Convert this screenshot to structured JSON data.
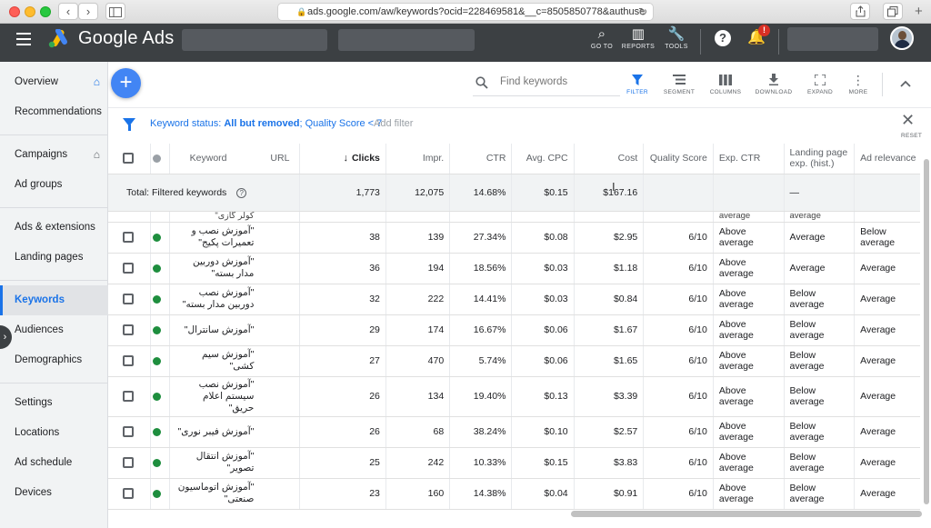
{
  "browser": {
    "url": "ads.google.com/aw/keywords?ocid=228469581&__c=8505850778&authuse",
    "back_glyph": "‹",
    "forward_glyph": "›"
  },
  "header": {
    "brand": "Google Ads",
    "tools": [
      {
        "label": "GO TO",
        "icon": "search-icon"
      },
      {
        "label": "REPORTS",
        "icon": "reports-icon"
      },
      {
        "label": "TOOLS",
        "icon": "wrench-icon"
      }
    ],
    "help_glyph": "?",
    "notification_badge": "!"
  },
  "sidebar": {
    "items": [
      {
        "label": "Overview"
      },
      {
        "label": "Recommendations"
      },
      {
        "label": "Campaigns"
      },
      {
        "label": "Ad groups"
      },
      {
        "label": "Ads & extensions"
      },
      {
        "label": "Landing pages"
      },
      {
        "label": "Keywords"
      },
      {
        "label": "Audiences"
      },
      {
        "label": "Demographics"
      },
      {
        "label": "Settings"
      },
      {
        "label": "Locations"
      },
      {
        "label": "Ad schedule"
      },
      {
        "label": "Devices"
      }
    ]
  },
  "toolbar": {
    "search_placeholder": "Find keywords",
    "tools": [
      {
        "label": "FILTER",
        "icon": "filter-icon"
      },
      {
        "label": "SEGMENT",
        "icon": "segment-icon"
      },
      {
        "label": "COLUMNS",
        "icon": "columns-icon"
      },
      {
        "label": "DOWNLOAD",
        "icon": "download-icon"
      },
      {
        "label": "EXPAND",
        "icon": "expand-icon"
      },
      {
        "label": "MORE",
        "icon": "more-icon"
      }
    ]
  },
  "filter": {
    "prefix": "Keyword status: ",
    "status_value": "All but removed",
    "sep": "; ",
    "quality": "Quality Score < 7",
    "add_filter": "Add filter",
    "reset": "RESET"
  },
  "table": {
    "headers": {
      "keyword": "Keyword",
      "url": "URL",
      "clicks": "Clicks",
      "impr": "Impr.",
      "ctr": "CTR",
      "avg_cpc": "Avg. CPC",
      "cost": "Cost",
      "quality_score": "Quality Score",
      "exp_ctr": "Exp. CTR",
      "landing_exp": "Landing page exp. (hist.)",
      "ad_relevance": "Ad relevance"
    },
    "total": {
      "label": "Total: Filtered keywords",
      "clicks": "1,773",
      "impr": "12,075",
      "ctr": "14.68%",
      "avg_cpc": "$0.15",
      "cost": "$167.16",
      "landing": "—"
    },
    "partial_row": {
      "keyword": "کولر گازی\"",
      "exp_ctr": "average",
      "landing": "average"
    },
    "rows": [
      {
        "keyword": "\"آموزش نصب و تعمیرات پکیج\"",
        "clicks": "38",
        "impr": "139",
        "ctr": "27.34%",
        "cpc": "$0.08",
        "cost": "$2.95",
        "qs": "6/10",
        "exp_ctr": "Above average",
        "landing": "Average",
        "relevance": "Below average"
      },
      {
        "keyword": "\"آموزش دوربین مدار بسته\"",
        "clicks": "36",
        "impr": "194",
        "ctr": "18.56%",
        "cpc": "$0.03",
        "cost": "$1.18",
        "qs": "6/10",
        "exp_ctr": "Above average",
        "landing": "Average",
        "relevance": "Average"
      },
      {
        "keyword": "\"آموزش نصب دوربین مدار بسته\"",
        "clicks": "32",
        "impr": "222",
        "ctr": "14.41%",
        "cpc": "$0.03",
        "cost": "$0.84",
        "qs": "6/10",
        "exp_ctr": "Above average",
        "landing": "Below average",
        "relevance": "Average"
      },
      {
        "keyword": "\"آموزش سانترال\"",
        "clicks": "29",
        "impr": "174",
        "ctr": "16.67%",
        "cpc": "$0.06",
        "cost": "$1.67",
        "qs": "6/10",
        "exp_ctr": "Above average",
        "landing": "Below average",
        "relevance": "Average"
      },
      {
        "keyword": "\"آموزش سیم کشی\"",
        "clicks": "27",
        "impr": "470",
        "ctr": "5.74%",
        "cpc": "$0.06",
        "cost": "$1.65",
        "qs": "6/10",
        "exp_ctr": "Above average",
        "landing": "Below average",
        "relevance": "Average"
      },
      {
        "keyword": "\"آموزش نصب سیستم اعلام حریق\"",
        "clicks": "26",
        "impr": "134",
        "ctr": "19.40%",
        "cpc": "$0.13",
        "cost": "$3.39",
        "qs": "6/10",
        "exp_ctr": "Above average",
        "landing": "Below average",
        "relevance": "Average"
      },
      {
        "keyword": "\"آموزش فیبر نوری\"",
        "clicks": "26",
        "impr": "68",
        "ctr": "38.24%",
        "cpc": "$0.10",
        "cost": "$2.57",
        "qs": "6/10",
        "exp_ctr": "Above average",
        "landing": "Below average",
        "relevance": "Average"
      },
      {
        "keyword": "\"آموزش انتقال تصویر\"",
        "clicks": "25",
        "impr": "242",
        "ctr": "10.33%",
        "cpc": "$0.15",
        "cost": "$3.83",
        "qs": "6/10",
        "exp_ctr": "Above average",
        "landing": "Below average",
        "relevance": "Average"
      },
      {
        "keyword": "\"آموزش اتوماسیون صنعتی\"",
        "clicks": "23",
        "impr": "160",
        "ctr": "14.38%",
        "cpc": "$0.04",
        "cost": "$0.91",
        "qs": "6/10",
        "exp_ctr": "Above average",
        "landing": "Below average",
        "relevance": "Average"
      }
    ]
  },
  "colors": {
    "accent": "#1a73e8",
    "header_bg": "#3c4043",
    "enabled_dot": "#1e8e3e",
    "fab": "#4285f4"
  }
}
